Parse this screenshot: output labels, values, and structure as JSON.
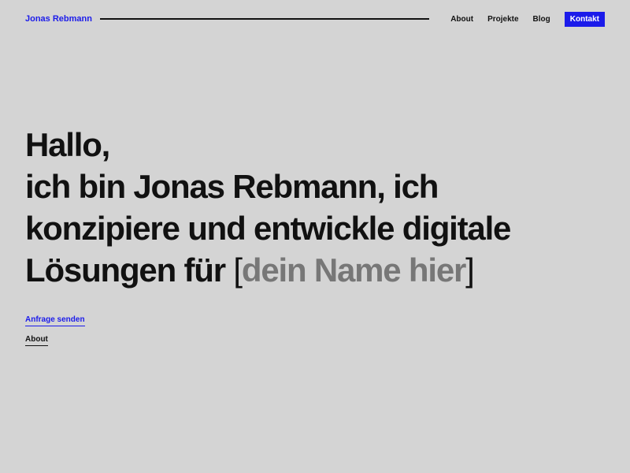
{
  "header": {
    "brand": "Jonas Rebmann",
    "nav": [
      {
        "label": "About"
      },
      {
        "label": "Projekte"
      },
      {
        "label": "Blog"
      },
      {
        "label": "Kontakt"
      }
    ]
  },
  "hero": {
    "line1": "Hallo,",
    "line2": "ich bin Jonas Rebmann, ich",
    "line3": "konzipiere und entwickle digitale",
    "line4_prefix": "Lösungen für ",
    "bracket_open": "[",
    "placeholder": "dein Name hier",
    "bracket_close": "]"
  },
  "actions": {
    "request_label": "Anfrage senden",
    "about_label": "About"
  },
  "colors": {
    "background": "#d4d4d4",
    "accent": "#1b1bea",
    "text": "#111111",
    "placeholder": "#777777"
  }
}
